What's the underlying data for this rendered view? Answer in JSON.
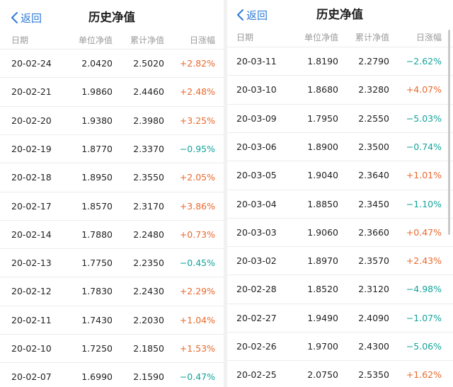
{
  "accent_color": "#2f7bd8",
  "positive_color": "#e8692e",
  "negative_color": "#14a39a",
  "icons": {
    "back": "chevron-left-icon"
  },
  "left": {
    "back_label": "返回",
    "title": "历史净值",
    "headers": {
      "date": "日期",
      "unit": "单位净值",
      "cumulative": "累计净值",
      "change": "日涨幅"
    },
    "rows": [
      {
        "date": "20-02-24",
        "unit": "2.0420",
        "cumulative": "2.5020",
        "change": "+2.82%"
      },
      {
        "date": "20-02-21",
        "unit": "1.9860",
        "cumulative": "2.4460",
        "change": "+2.48%"
      },
      {
        "date": "20-02-20",
        "unit": "1.9380",
        "cumulative": "2.3980",
        "change": "+3.25%"
      },
      {
        "date": "20-02-19",
        "unit": "1.8770",
        "cumulative": "2.3370",
        "change": "−0.95%"
      },
      {
        "date": "20-02-18",
        "unit": "1.8950",
        "cumulative": "2.3550",
        "change": "+2.05%"
      },
      {
        "date": "20-02-17",
        "unit": "1.8570",
        "cumulative": "2.3170",
        "change": "+3.86%"
      },
      {
        "date": "20-02-14",
        "unit": "1.7880",
        "cumulative": "2.2480",
        "change": "+0.73%"
      },
      {
        "date": "20-02-13",
        "unit": "1.7750",
        "cumulative": "2.2350",
        "change": "−0.45%"
      },
      {
        "date": "20-02-12",
        "unit": "1.7830",
        "cumulative": "2.2430",
        "change": "+2.29%"
      },
      {
        "date": "20-02-11",
        "unit": "1.7430",
        "cumulative": "2.2030",
        "change": "+1.04%"
      },
      {
        "date": "20-02-10",
        "unit": "1.7250",
        "cumulative": "2.1850",
        "change": "+1.53%"
      },
      {
        "date": "20-02-07",
        "unit": "1.6990",
        "cumulative": "2.1590",
        "change": "−0.47%"
      }
    ]
  },
  "right": {
    "back_label": "返回",
    "title": "历史净值",
    "headers": {
      "date": "日期",
      "unit": "单位净值",
      "cumulative": "累计净值",
      "change": "日涨幅"
    },
    "rows": [
      {
        "date": "20-03-11",
        "unit": "1.8190",
        "cumulative": "2.2790",
        "change": "−2.62%"
      },
      {
        "date": "20-03-10",
        "unit": "1.8680",
        "cumulative": "2.3280",
        "change": "+4.07%"
      },
      {
        "date": "20-03-09",
        "unit": "1.7950",
        "cumulative": "2.2550",
        "change": "−5.03%"
      },
      {
        "date": "20-03-06",
        "unit": "1.8900",
        "cumulative": "2.3500",
        "change": "−0.74%"
      },
      {
        "date": "20-03-05",
        "unit": "1.9040",
        "cumulative": "2.3640",
        "change": "+1.01%"
      },
      {
        "date": "20-03-04",
        "unit": "1.8850",
        "cumulative": "2.3450",
        "change": "−1.10%"
      },
      {
        "date": "20-03-03",
        "unit": "1.9060",
        "cumulative": "2.3660",
        "change": "+0.47%"
      },
      {
        "date": "20-03-02",
        "unit": "1.8970",
        "cumulative": "2.3570",
        "change": "+2.43%"
      },
      {
        "date": "20-02-28",
        "unit": "1.8520",
        "cumulative": "2.3120",
        "change": "−4.98%"
      },
      {
        "date": "20-02-27",
        "unit": "1.9490",
        "cumulative": "2.4090",
        "change": "−1.07%"
      },
      {
        "date": "20-02-26",
        "unit": "1.9700",
        "cumulative": "2.4300",
        "change": "−5.06%"
      },
      {
        "date": "20-02-25",
        "unit": "2.0750",
        "cumulative": "2.5350",
        "change": "+1.62%"
      }
    ]
  }
}
